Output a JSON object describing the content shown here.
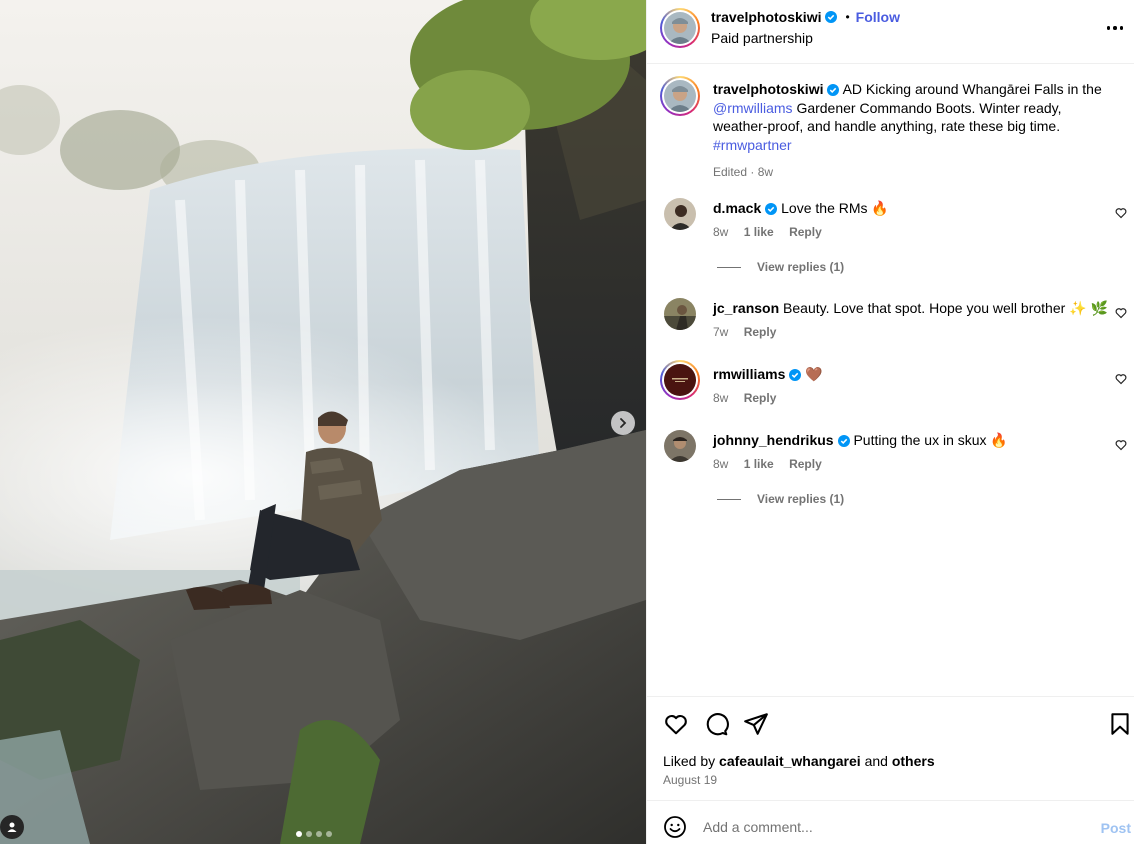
{
  "post": {
    "author": "travelphotoskiwi",
    "follow_label": "Follow",
    "separator": "•",
    "subtitle": "Paid partnership",
    "more_icon": "more-horizontal-icon"
  },
  "caption": {
    "author": "travelphotoskiwi",
    "text_1": "AD Kicking around Whangārei Falls in the",
    "mention": "@rmwilliams",
    "text_2": "Gardener Commando Boots. Winter ready, weather-proof, and handle anything, rate these big time.",
    "hashtag": "#rmwpartner",
    "edited": "Edited",
    "dot": "·",
    "time": "8w"
  },
  "comments": [
    {
      "user": "d.mack",
      "verified": true,
      "text": "Love the RMs 🔥",
      "time": "8w",
      "likes": "1 like",
      "reply": "Reply",
      "replies": "View replies (1)"
    },
    {
      "user": "jc_ranson",
      "verified": false,
      "text": "Beauty. Love that spot. Hope you well brother ✨ 🌿",
      "time": "7w",
      "likes": "",
      "reply": "Reply",
      "replies": ""
    },
    {
      "user": "rmwilliams",
      "verified": true,
      "text": "🤎",
      "time": "8w",
      "likes": "",
      "reply": "Reply",
      "replies": ""
    },
    {
      "user": "johnny_hendrikus",
      "verified": true,
      "text": "Putting the ux in skux 🔥",
      "time": "8w",
      "likes": "1 like",
      "reply": "Reply",
      "replies": "View replies (1)"
    }
  ],
  "likes": {
    "prefix": "Liked by",
    "user": "cafeaulait_whangarei",
    "and": "and",
    "others": "others",
    "date": "August 19"
  },
  "composer": {
    "placeholder": "Add a comment...",
    "post_label": "Post"
  },
  "carousel": {
    "total": 4,
    "active": 1
  },
  "colors": {
    "link": "#4a5ce0",
    "muted": "#737373",
    "verified": "#0095f6",
    "post_disabled": "#9fc3f2"
  }
}
